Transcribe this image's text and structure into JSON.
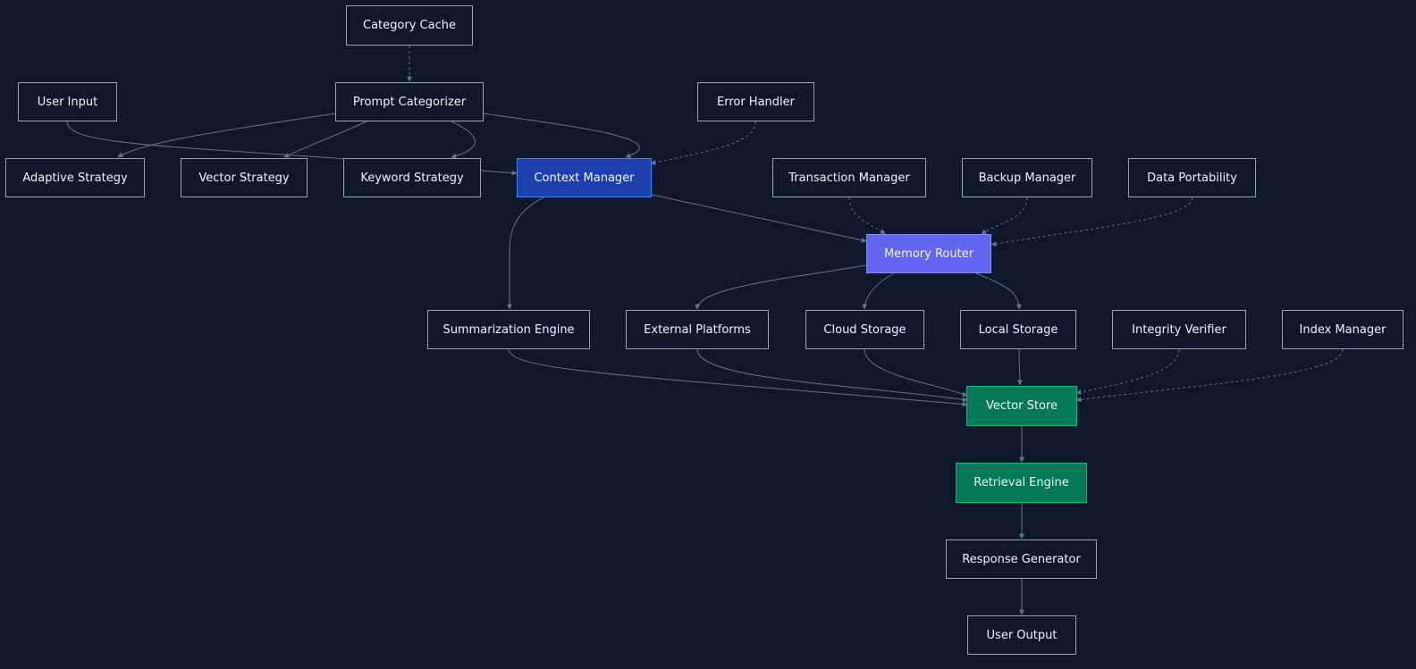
{
  "diagram": {
    "colors": {
      "background": "#0f172a",
      "edge": "#64748b",
      "context_manager": "#1e40af",
      "memory_router": "#6366f1",
      "storage_green": "#047857"
    },
    "nodes": {
      "category_cache": "Category Cache",
      "user_input": "User Input",
      "prompt_categorizer": "Prompt Categorizer",
      "error_handler": "Error Handler",
      "adaptive_strategy": "Adaptive Strategy",
      "vector_strategy": "Vector Strategy",
      "keyword_strategy": "Keyword Strategy",
      "context_manager": "Context Manager",
      "transaction_manager": "Transaction Manager",
      "backup_manager": "Backup Manager",
      "data_portability": "Data Portability",
      "memory_router": "Memory Router",
      "summarization_engine": "Summarization Engine",
      "external_platforms": "External Platforms",
      "cloud_storage": "Cloud Storage",
      "local_storage": "Local Storage",
      "integrity_verifier": "Integrity Verifier",
      "index_manager": "Index Manager",
      "vector_store": "Vector Store",
      "retrieval_engine": "Retrieval Engine",
      "response_generator": "Response Generator",
      "user_output": "User Output"
    }
  }
}
